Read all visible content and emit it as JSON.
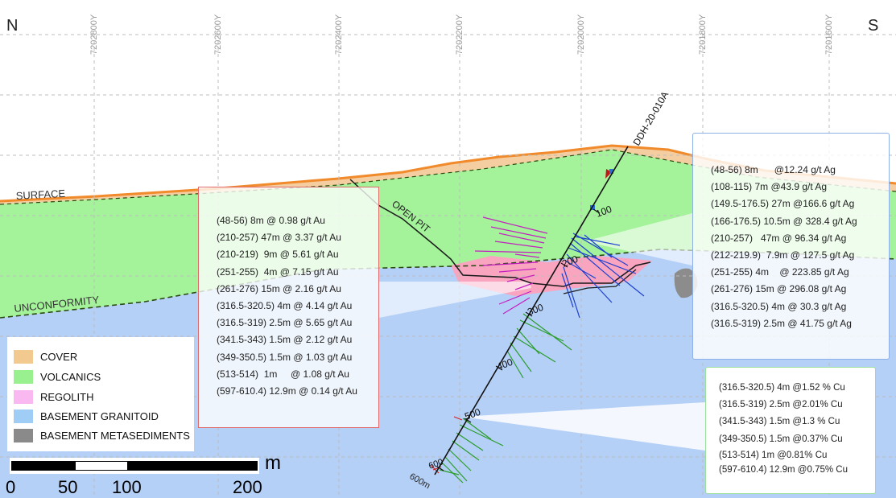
{
  "compass": {
    "left": "N",
    "right": "S"
  },
  "eastings": [
    "7202800Y",
    "7202600Y",
    "7202400Y",
    "7202200Y",
    "7202000Y",
    "7201800Y",
    "7201600Y"
  ],
  "labels": {
    "surface": "SURFACE",
    "unconformity": "UNCONFORMITY",
    "open_pit": "OPEN PIT",
    "drillhole": "DDH-20-010A",
    "depth_100": "100",
    "depth_200": "200",
    "depth_300": "300",
    "depth_400": "400",
    "depth_500": "500",
    "depth_600": "600",
    "depth_end": "600m"
  },
  "au_intercepts": [
    "(48-56) 8m @ 0.98 g/t Au",
    "(210-257) 47m @ 3.37 g/t Au",
    "(210-219)  9m @ 5.61 g/t Au",
    "(251-255)  4m @ 7.15 g/t Au",
    "(261-276) 15m @ 2.16 g/t Au",
    "(316.5-320.5) 4m @ 4.14 g/t Au",
    "(316.5-319) 2.5m @ 5.65 g/t Au",
    "(341.5-343) 1.5m @ 2.12 g/t Au",
    "(349-350.5) 1.5m @ 1.03 g/t Au",
    "(513-514)  1m     @ 1.08 g/t Au",
    "(597-610.4) 12.9m @ 0.14 g/t Au"
  ],
  "ag_intercepts": [
    "(48-56) 8m      @12.24 g/t Ag",
    "(108-115) 7m @43.9 g/t Ag",
    "(149.5-176.5) 27m @166.6 g/t Ag",
    "(166-176.5) 10.5m @ 328.4 g/t Ag",
    "(210-257)   47m @ 96.34 g/t Ag",
    "(212-219.9)  7.9m @ 127.5 g/t Ag",
    "(251-255) 4m    @ 223.85 g/t Ag",
    "(261-276) 15m @ 296.08 g/t Ag",
    "(316.5-320.5) 4m @ 30.3 g/t Ag",
    "(316.5-319) 2.5m @ 41.75 g/t Ag"
  ],
  "cu_intercepts": [
    "(316.5-320.5) 4m @1.52 % Cu",
    "(316.5-319) 2.5m @2.01% Cu",
    "(341.5-343) 1.5m @1.3 % Cu",
    "(349-350.5) 1.5m @0.37% Cu",
    "(513-514) 1m @0.81% Cu",
    "(597-610.4) 12.9m @0.75% Cu"
  ],
  "legend": [
    {
      "label": "COVER",
      "color": "#f2c98e"
    },
    {
      "label": "VOLCANICS",
      "color": "#99f08f"
    },
    {
      "label": "REGOLITH",
      "color": "#fab8f0"
    },
    {
      "label": "BASEMENT GRANITOID",
      "color": "#9fcdf5"
    },
    {
      "label": "BASEMENT METASEDIMENTS",
      "color": "#8a8a8a"
    }
  ],
  "scale": {
    "unit": "m",
    "ticks": [
      "0",
      "50",
      "100",
      "200"
    ]
  }
}
